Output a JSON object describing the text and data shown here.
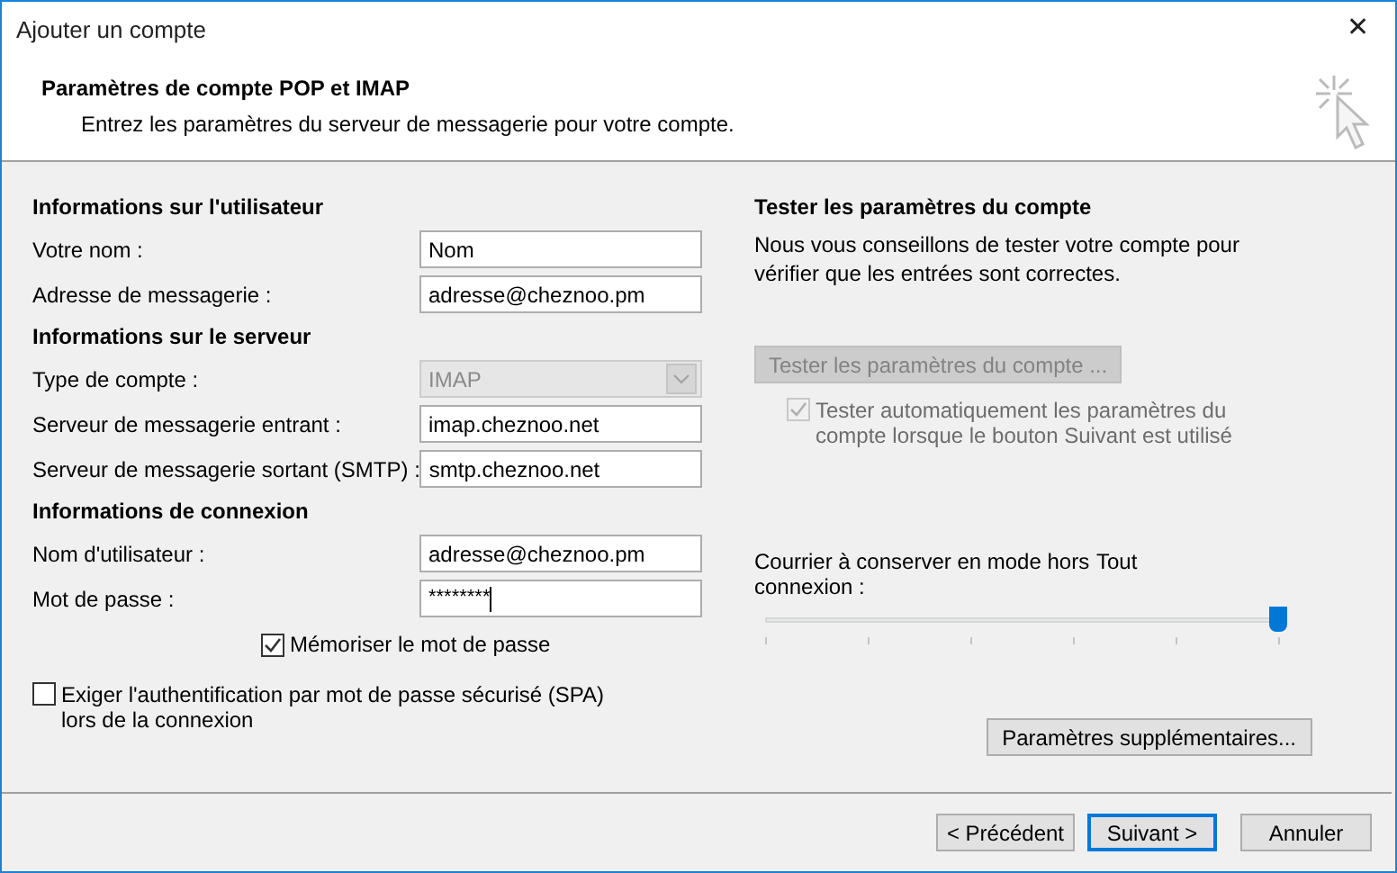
{
  "window": {
    "title": "Ajouter un compte",
    "close": "✕"
  },
  "header": {
    "title": "Paramètres de compte POP et IMAP",
    "subtitle": "Entrez les paramètres du serveur de messagerie pour votre compte."
  },
  "sections": [
    {
      "heading": "Informations sur l'utilisateur",
      "fields": [
        {
          "kind": "text",
          "label": "Votre nom :",
          "value": "Nom"
        },
        {
          "kind": "text",
          "label": "Adresse de messagerie :",
          "value": "adresse@cheznoo.pm"
        }
      ]
    },
    {
      "heading": "Informations sur le serveur",
      "fields": [
        {
          "kind": "select",
          "label": "Type de compte :",
          "value": "IMAP",
          "disabled": true
        },
        {
          "kind": "text",
          "label": "Serveur de messagerie entrant :",
          "value": "imap.cheznoo.net"
        },
        {
          "kind": "text",
          "label": "Serveur de messagerie sortant (SMTP) :",
          "value": "smtp.cheznoo.net"
        }
      ]
    },
    {
      "heading": "Informations de connexion",
      "fields": [
        {
          "kind": "text",
          "label": "Nom d'utilisateur :",
          "value": "adresse@cheznoo.pm"
        },
        {
          "kind": "password",
          "label": "Mot de passe :",
          "value": "********"
        }
      ]
    }
  ],
  "remember_password": {
    "label": "Mémoriser le mot de passe",
    "checked": true
  },
  "spa": {
    "label": "Exiger l'authentification par mot de passe sécurisé (SPA) lors de la connexion",
    "checked": false
  },
  "test": {
    "heading": "Tester les paramètres du compte",
    "description": "Nous vous conseillons de tester votre compte pour vérifier que les entrées sont correctes.",
    "button": {
      "label": "Tester les paramètres du compte ...",
      "disabled": true
    },
    "auto_test": {
      "label": "Tester automatiquement les paramètres du compte lorsque le bouton Suivant est utilisé",
      "checked": true,
      "disabled": true
    }
  },
  "offline": {
    "label": "Courrier à conserver en mode hors connexion :",
    "reading": "Tout",
    "level": 1
  },
  "more_settings": "Paramètres supplémentaires...",
  "buttons": [
    {
      "label": "< Précédent",
      "default": false
    },
    {
      "label": "Suivant >",
      "default": true
    },
    {
      "label": "Annuler",
      "default": false
    }
  ]
}
